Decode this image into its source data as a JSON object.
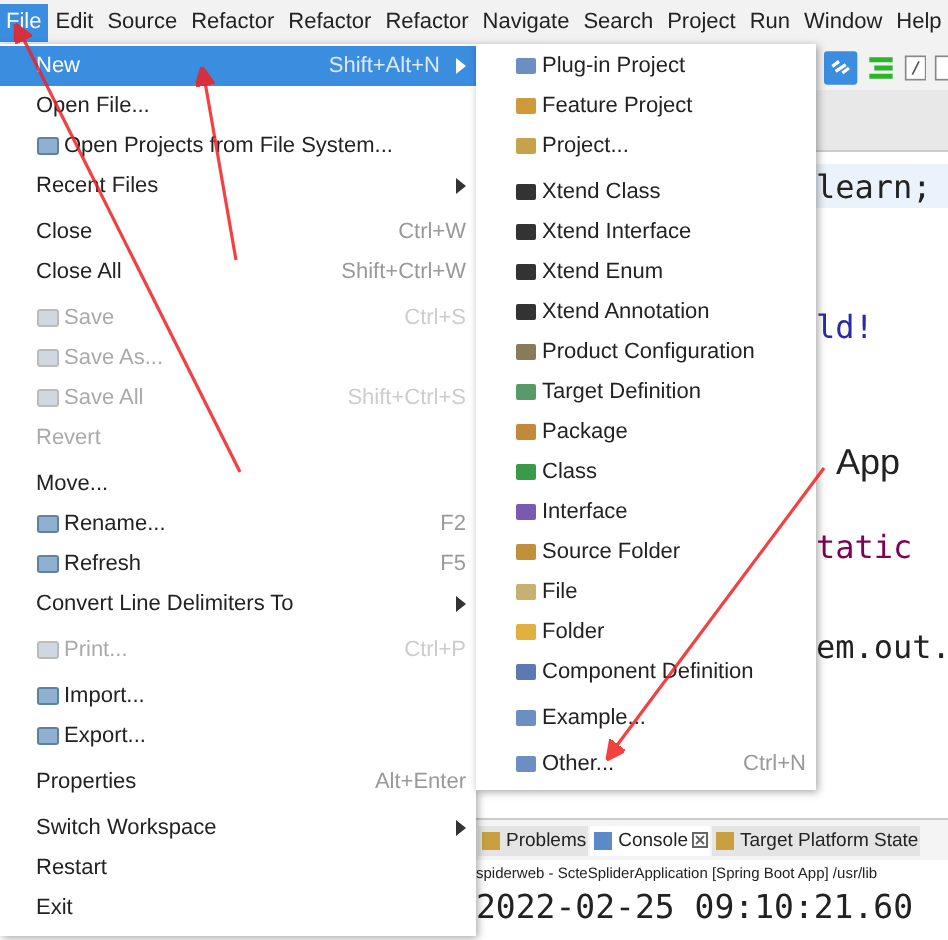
{
  "menubar": [
    {
      "label": "File",
      "selected": true
    },
    {
      "label": "Edit",
      "selected": false
    },
    {
      "label": "Source",
      "selected": false
    },
    {
      "label": "Refactor",
      "selected": false
    },
    {
      "label": "Refactor",
      "selected": false
    },
    {
      "label": "Refactor",
      "selected": false
    },
    {
      "label": "Navigate",
      "selected": false
    },
    {
      "label": "Search",
      "selected": false
    },
    {
      "label": "Project",
      "selected": false
    },
    {
      "label": "Run",
      "selected": false
    },
    {
      "label": "Window",
      "selected": false
    },
    {
      "label": "Help",
      "selected": false
    }
  ],
  "editor": {
    "lines": [
      {
        "text": "learn;",
        "current": true
      },
      {
        "text": "ld!",
        "current": false
      },
      {
        "text": "App",
        "current": false
      },
      {
        "text": "tatic",
        "current": false
      },
      {
        "text": "em.out.",
        "current": false
      }
    ]
  },
  "bottom_panel": {
    "tabs": [
      {
        "label": "Problems",
        "selected": false
      },
      {
        "label": "Console",
        "selected": true
      },
      {
        "label": "Target Platform State",
        "selected": false
      }
    ],
    "console_title": "spiderweb - ScteSpliderApplication [Spring Boot App] /usr/lib",
    "console_output": "2022-02-25 09:10:21.60"
  },
  "file_menu": [
    {
      "kind": "item",
      "label": "New",
      "shortcut": "Shift+Alt+N",
      "submenu": true,
      "icon": false,
      "disabled": false,
      "selected": true
    },
    {
      "kind": "item",
      "label": "Open File...",
      "icon": false,
      "disabled": false,
      "selected": false
    },
    {
      "kind": "item",
      "label": "Open Projects from File System...",
      "icon": true,
      "disabled": false,
      "selected": false
    },
    {
      "kind": "item",
      "label": "Recent Files",
      "submenu": true,
      "icon": false,
      "disabled": false,
      "selected": false
    },
    {
      "kind": "separator"
    },
    {
      "kind": "item",
      "label": "Close",
      "shortcut": "Ctrl+W",
      "icon": false,
      "disabled": false,
      "selected": false
    },
    {
      "kind": "item",
      "label": "Close All",
      "shortcut": "Shift+Ctrl+W",
      "icon": false,
      "disabled": false,
      "selected": false
    },
    {
      "kind": "separator"
    },
    {
      "kind": "item",
      "label": "Save",
      "shortcut": "Ctrl+S",
      "icon": true,
      "disabled": true,
      "selected": false
    },
    {
      "kind": "item",
      "label": "Save As...",
      "icon": true,
      "disabled": true,
      "selected": false
    },
    {
      "kind": "item",
      "label": "Save All",
      "shortcut": "Shift+Ctrl+S",
      "icon": true,
      "disabled": true,
      "selected": false
    },
    {
      "kind": "item",
      "label": "Revert",
      "icon": false,
      "disabled": true,
      "selected": false
    },
    {
      "kind": "separator"
    },
    {
      "kind": "item",
      "label": "Move...",
      "icon": false,
      "disabled": false,
      "selected": false
    },
    {
      "kind": "item",
      "label": "Rename...",
      "shortcut": "F2",
      "icon": true,
      "disabled": false,
      "selected": false
    },
    {
      "kind": "item",
      "label": "Refresh",
      "shortcut": "F5",
      "icon": true,
      "disabled": false,
      "selected": false
    },
    {
      "kind": "item",
      "label": "Convert Line Delimiters To",
      "submenu": true,
      "icon": false,
      "disabled": false,
      "selected": false
    },
    {
      "kind": "separator"
    },
    {
      "kind": "item",
      "label": "Print...",
      "shortcut": "Ctrl+P",
      "icon": true,
      "disabled": true,
      "selected": false
    },
    {
      "kind": "separator"
    },
    {
      "kind": "item",
      "label": "Import...",
      "icon": true,
      "disabled": false,
      "selected": false
    },
    {
      "kind": "item",
      "label": "Export...",
      "icon": true,
      "disabled": false,
      "selected": false
    },
    {
      "kind": "separator"
    },
    {
      "kind": "item",
      "label": "Properties",
      "shortcut": "Alt+Enter",
      "icon": false,
      "disabled": false,
      "selected": false
    },
    {
      "kind": "separator"
    },
    {
      "kind": "item",
      "label": "Switch Workspace",
      "submenu": true,
      "icon": false,
      "disabled": false,
      "selected": false
    },
    {
      "kind": "item",
      "label": "Restart",
      "icon": false,
      "disabled": false,
      "selected": false
    },
    {
      "kind": "item",
      "label": "Exit",
      "icon": false,
      "disabled": false,
      "selected": false
    }
  ],
  "new_submenu": [
    {
      "kind": "item",
      "label": "Plug-in Project",
      "color": "#6a8fc0"
    },
    {
      "kind": "item",
      "label": "Feature Project",
      "color": "#d09a3a"
    },
    {
      "kind": "item",
      "label": "Project...",
      "color": "#c8a24a"
    },
    {
      "kind": "separator"
    },
    {
      "kind": "item",
      "label": "Xtend Class",
      "color": "#333333"
    },
    {
      "kind": "item",
      "label": "Xtend Interface",
      "color": "#333333"
    },
    {
      "kind": "item",
      "label": "Xtend Enum",
      "color": "#333333"
    },
    {
      "kind": "item",
      "label": "Xtend Annotation",
      "color": "#333333"
    },
    {
      "kind": "item",
      "label": "Product Configuration",
      "color": "#8a7a5a"
    },
    {
      "kind": "item",
      "label": "Target Definition",
      "color": "#5a9a6a"
    },
    {
      "kind": "item",
      "label": "Package",
      "color": "#c08a3a"
    },
    {
      "kind": "item",
      "label": "Class",
      "color": "#3a9a4a"
    },
    {
      "kind": "item",
      "label": "Interface",
      "color": "#7a5ab0"
    },
    {
      "kind": "item",
      "label": "Source Folder",
      "color": "#c0903a"
    },
    {
      "kind": "item",
      "label": "File",
      "color": "#c8b070"
    },
    {
      "kind": "item",
      "label": "Folder",
      "color": "#e0b040"
    },
    {
      "kind": "item",
      "label": "Component Definition",
      "color": "#5a7ab0"
    },
    {
      "kind": "separator"
    },
    {
      "kind": "item",
      "label": "Example...",
      "color": "#6a8fc0"
    },
    {
      "kind": "separator"
    },
    {
      "kind": "item",
      "label": "Other...",
      "shortcut": "Ctrl+N",
      "color": "#6a8fc0"
    }
  ]
}
